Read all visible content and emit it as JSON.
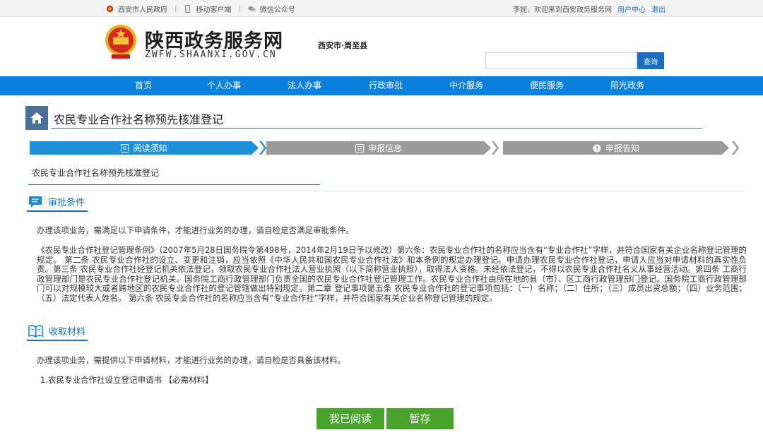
{
  "topbar": {
    "gov_link": "西安市人民政府",
    "mobile_link": "移动客户端",
    "wechat_link": "微信公众号",
    "welcome": "李妮，欢迎来到西安政务服务网",
    "user_center": "用户中心",
    "logout": "退出"
  },
  "header": {
    "site_title": "陕西政务服务网",
    "site_url": "ZWFW.SHAANXI.GOV.CN",
    "location": "西安市·周至县",
    "search_button": "查询",
    "search_value": ""
  },
  "nav": [
    "首页",
    "个人办事",
    "法人办事",
    "行政审批",
    "中介服务",
    "便民服务",
    "阳光政务"
  ],
  "page": {
    "title": "农民专业合作社名称预先核准登记",
    "subject": "农民专业合作社名称预先核准登记"
  },
  "steps": [
    {
      "label": "阅读须知",
      "icon": "document-icon",
      "active": true
    },
    {
      "label": "申报信息",
      "icon": "list-icon",
      "active": false
    },
    {
      "label": "申报告知",
      "icon": "alert-icon",
      "active": false
    }
  ],
  "conditions": {
    "heading": "审批条件",
    "intro": "办理该项业务，需满足以下申请条件，才能进行业务的办理，请自检是否满足审批条件。",
    "body": "《农民专业合作社登记管理条例》（2007年5月28日国务院令第498号，2014年2月19日予以修改）第六条：农民专业合作社的名称应当含有“专业合作社”字样，并符合国家有关企业名称登记管理的规定。 第二条 农民专业合作社的设立、变更和注销，应当依照《中华人民共和国农民专业合作社法》和本条例的规定办理登记。申请办理农民专业合作社登记，申请人应当对申请材料的真实性负责。第三条 农民专业合作社经登记机关依法登记，领取农民专业合作社法人营业执照（以下简称营业执照），取得法人资格。未经依法登记，不得以农民专业合作社名义从事经营活动。第四条 工商行政管理部门是农民专业合作社登记机关。国务院工商行政管理部门负责全国的农民专业合作社登记管理工作。农民专业合作社由所在地的县（市）、区工商行政管理部门登记。国务院工商行政管理部门可以对规模较大或者跨地区的农民专业合作社的登记管辖做出特别规定。第二章 登记事项第五条 农民专业合作社的登记事项包括：（一）名称；（二）住所；（三）成员出资总额；（四）业务范围；（五）法定代表人姓名。 第六条 农民专业合作社的名称应当含有“专业合作社”字样，并符合国家有关企业名称登记管理的规定。"
  },
  "materials": {
    "heading": "收取材料",
    "intro": "办理该项业务，需提供以下申请材料，才能进行业务的办理，请自检是否具备该材料。",
    "items": [
      "1.农民专业合作社设立登记申请书 【必需材料】"
    ]
  },
  "buttons": {
    "read": "我已阅读",
    "save": "暂存"
  },
  "colors": {
    "primary": "#0d7fdd",
    "step_active": "#1e8fd8",
    "step_inactive": "#9a9a9a",
    "accent_green": "#4aa32a"
  }
}
